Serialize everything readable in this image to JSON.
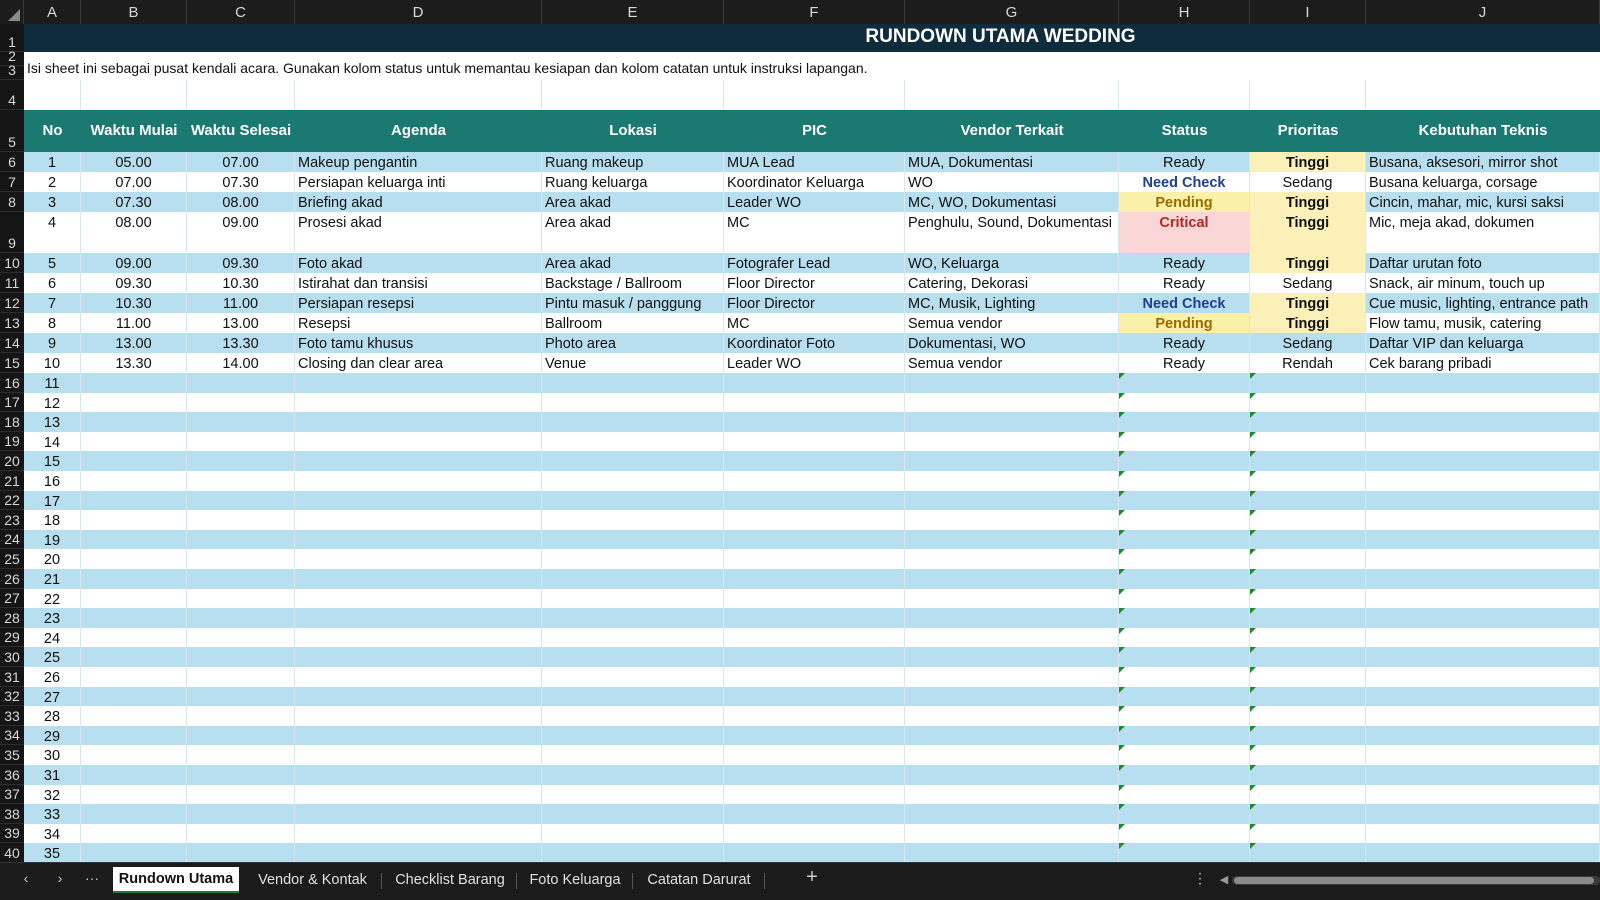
{
  "columns": [
    "A",
    "B",
    "C",
    "D",
    "E",
    "F",
    "G",
    "H",
    "I",
    "J"
  ],
  "title": "RUNDOWN UTAMA WEDDING",
  "description": "Isi sheet ini sebagai pusat kendali acara. Gunakan kolom status untuk memantau kesiapan dan kolom catatan untuk instruksi lapangan.",
  "headers": [
    "No",
    "Waktu Mulai",
    "Waktu Selesai",
    "Agenda",
    "Lokasi",
    "PIC",
    "Vendor Terkait",
    "Status",
    "Prioritas",
    "Kebutuhan Teknis"
  ],
  "rows": [
    [
      "1",
      "05.00",
      "07.00",
      "Makeup pengantin",
      "Ruang makeup",
      "MUA Lead",
      "MUA, Dokumentasi",
      "Ready",
      "Tinggi",
      "Busana, aksesori, mirror shot"
    ],
    [
      "2",
      "07.00",
      "07.30",
      "Persiapan keluarga inti",
      "Ruang keluarga",
      "Koordinator Keluarga",
      "WO",
      "Need Check",
      "Sedang",
      "Busana keluarga, corsage"
    ],
    [
      "3",
      "07.30",
      "08.00",
      "Briefing akad",
      "Area akad",
      "Leader WO",
      "MC, WO, Dokumentasi",
      "Pending",
      "Tinggi",
      "Cincin, mahar, mic, kursi saksi"
    ],
    [
      "4",
      "08.00",
      "09.00",
      "Prosesi akad",
      "Area akad",
      "MC",
      "Penghulu, Sound, Dokumentasi",
      "Critical",
      "Tinggi",
      "Mic, meja akad, dokumen"
    ],
    [
      "5",
      "09.00",
      "09.30",
      "Foto akad",
      "Area akad",
      "Fotografer Lead",
      "WO, Keluarga",
      "Ready",
      "Tinggi",
      "Daftar urutan foto"
    ],
    [
      "6",
      "09.30",
      "10.30",
      "Istirahat dan transisi",
      "Backstage / Ballroom",
      "Floor Director",
      "Catering, Dekorasi",
      "Ready",
      "Sedang",
      "Snack, air minum, touch up"
    ],
    [
      "7",
      "10.30",
      "11.00",
      "Persiapan resepsi",
      "Pintu masuk / panggung",
      "Floor Director",
      "MC, Musik, Lighting",
      "Need Check",
      "Tinggi",
      "Cue music, lighting, entrance path"
    ],
    [
      "8",
      "11.00",
      "13.00",
      "Resepsi",
      "Ballroom",
      "MC",
      "Semua vendor",
      "Pending",
      "Tinggi",
      "Flow tamu, musik, catering"
    ],
    [
      "9",
      "13.00",
      "13.30",
      "Foto tamu khusus",
      "Photo area",
      "Koordinator Foto",
      "Dokumentasi, WO",
      "Ready",
      "Sedang",
      "Daftar VIP dan keluarga"
    ],
    [
      "10",
      "13.30",
      "14.00",
      "Closing dan clear area",
      "Venue",
      "Leader WO",
      "Semua vendor",
      "Ready",
      "Rendah",
      "Cek barang pribadi"
    ]
  ],
  "empty_rows": [
    "11",
    "12",
    "13",
    "14",
    "15",
    "16",
    "17",
    "18",
    "19",
    "20",
    "21",
    "22",
    "23",
    "24",
    "25",
    "26",
    "27",
    "28",
    "29",
    "30",
    "31",
    "32",
    "33",
    "34",
    "35"
  ],
  "row_numbers": [
    "1",
    "2",
    "3",
    "4",
    "5",
    "6",
    "7",
    "8",
    "9",
    "10",
    "11",
    "12",
    "13",
    "14",
    "15",
    "16",
    "17",
    "18",
    "19",
    "20",
    "21",
    "22",
    "23",
    "24",
    "25",
    "26",
    "27",
    "28",
    "29",
    "30",
    "31",
    "32",
    "33",
    "34",
    "35",
    "36",
    "37",
    "38",
    "39",
    "40"
  ],
  "status_styles": {
    "Ready": {
      "color": "#101010",
      "bg": "",
      "bold": false
    },
    "Need Check": {
      "color": "#1f3f8f",
      "bg": "",
      "bold": true
    },
    "Pending": {
      "color": "#9a6a00",
      "bg": "#fbf0a8",
      "bold": true
    },
    "Critical": {
      "color": "#b3262a",
      "bg": "#fbd6d6",
      "bold": true
    }
  },
  "priority_styles": {
    "Tinggi": {
      "color": "#101010",
      "bg": "#fbf0b8",
      "bold": true
    },
    "Sedang": {
      "color": "#101010",
      "bg": "",
      "bold": false
    },
    "Rendah": {
      "color": "#101010",
      "bg": "",
      "bold": false
    }
  },
  "colors": {
    "title_bg": "#0e2c3c",
    "header_bg": "#1a7a72",
    "band_blue": "#b8dff0",
    "band_white": "#ffffff",
    "note_triangle": "#1f8a2e"
  },
  "sheet_tabs": [
    "Rundown Utama",
    "Vendor & Kontak",
    "Checklist Barang",
    "Foto Keluarga",
    "Catatan Darurat"
  ],
  "active_tab": "Rundown Utama",
  "tabbar": {
    "prev": "‹",
    "next": "›",
    "more": "···",
    "add": "+",
    "options": "⋮"
  }
}
